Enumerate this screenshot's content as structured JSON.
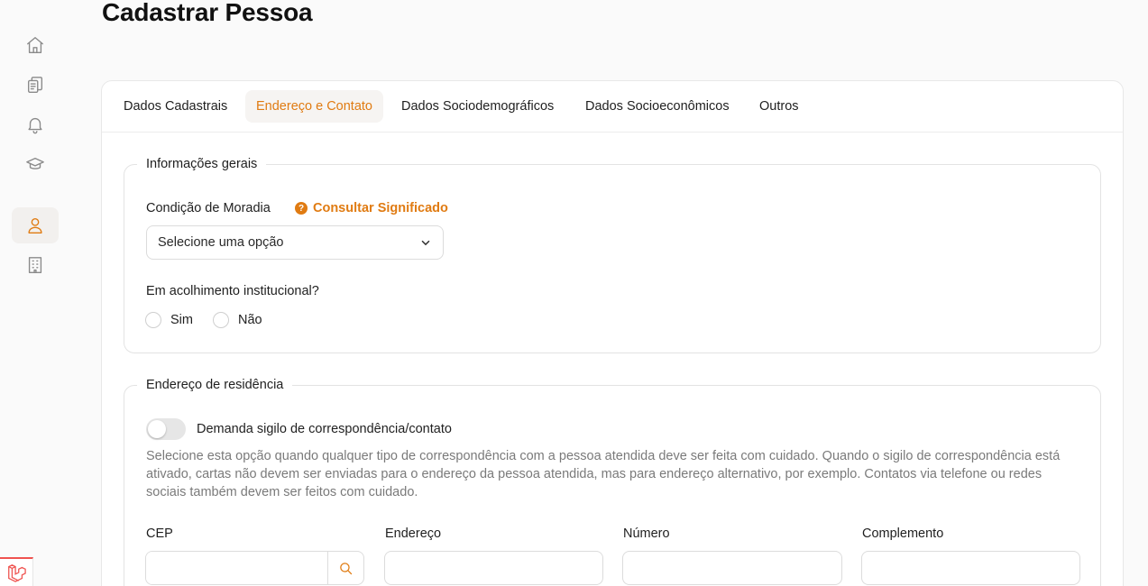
{
  "page": {
    "title": "Cadastrar Pessoa"
  },
  "sidebar": {
    "items": [
      {
        "icon": "home-icon"
      },
      {
        "icon": "documents-icon"
      },
      {
        "icon": "bell-icon"
      },
      {
        "icon": "graduation-cap-icon"
      },
      {
        "icon": "user-icon",
        "active": true
      },
      {
        "icon": "building-icon"
      }
    ],
    "accent_color": "#e07b12"
  },
  "tabs": [
    {
      "label": "Dados Cadastrais"
    },
    {
      "label": "Endereço e Contato",
      "active": true
    },
    {
      "label": "Dados Sociodemográficos"
    },
    {
      "label": "Dados Socioeconômicos"
    },
    {
      "label": "Outros"
    }
  ],
  "general": {
    "legend": "Informações gerais",
    "housing_label": "Condição de Moradia",
    "help_link": "Consultar Significado",
    "select_value": "Selecione uma opção",
    "shelter_question": "Em acolhimento institucional?",
    "option_yes": "Sim",
    "option_no": "Não"
  },
  "address": {
    "legend": "Endereço de residência",
    "toggle_label": "Demanda sigilo de correspondência/contato",
    "toggle_on": false,
    "description": "Selecione esta opção quando qualquer tipo de correspondência com a pessoa atendida deve ser feita com cuidado. Quando o sigilo de correspondência está ativado, cartas não devem ser enviadas para o endereço da pessoa atendida, mas para endereço alternativo, por exemplo. Contatos via telefone ou redes sociais também devem ser feitos com cuidado.",
    "cep_label": "CEP",
    "street_label": "Endereço",
    "number_label": "Número",
    "complement_label": "Complemento"
  }
}
